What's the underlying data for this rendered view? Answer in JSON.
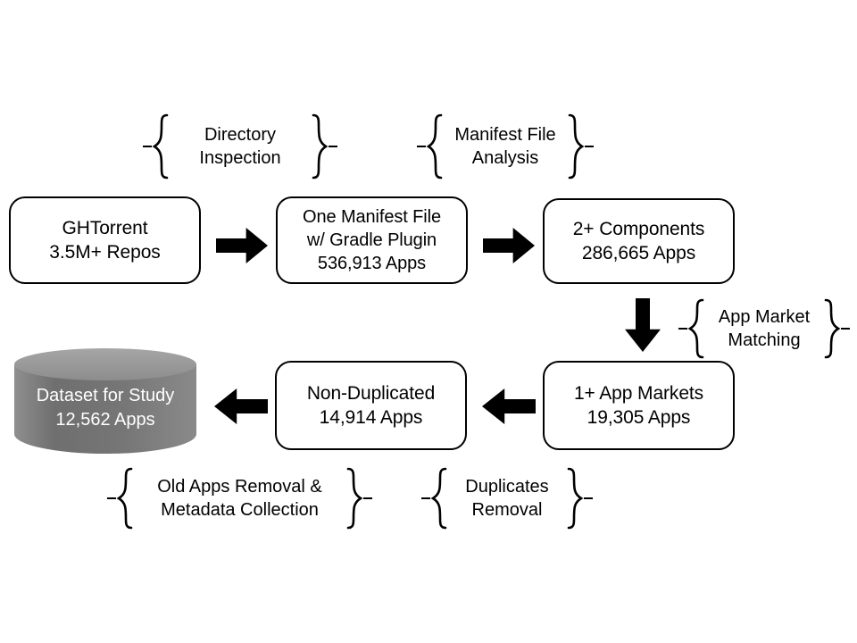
{
  "diagram": {
    "title": "App dataset construction pipeline",
    "background_color": "#ffffff",
    "line_color": "#000000",
    "cylinder_fill": "#767676",
    "cylinder_text_color": "#ffffff",
    "nodes": [
      {
        "id": "ghtorrent",
        "shape": "rounded-rect",
        "lines": [
          "GHTorrent",
          "3.5M+ Repos"
        ]
      },
      {
        "id": "one-manifest-file",
        "shape": "rounded-rect",
        "lines": [
          "One Manifest File",
          "w/ Gradle Plugin",
          "536,913 Apps"
        ]
      },
      {
        "id": "two-plus-components",
        "shape": "rounded-rect",
        "lines": [
          "2+ Components",
          "286,665 Apps"
        ]
      },
      {
        "id": "one-plus-app-markets",
        "shape": "rounded-rect",
        "lines": [
          "1+ App Markets",
          "19,305 Apps"
        ]
      },
      {
        "id": "non-duplicated",
        "shape": "rounded-rect",
        "lines": [
          "Non-Duplicated",
          "14,914 Apps"
        ]
      },
      {
        "id": "dataset-for-study",
        "shape": "cylinder",
        "lines": [
          "Dataset for Study",
          "12,562 Apps"
        ]
      }
    ],
    "annotations": [
      {
        "id": "directory-inspection",
        "lines": [
          "Directory",
          "Inspection"
        ]
      },
      {
        "id": "manifest-file-analysis",
        "lines": [
          "Manifest File",
          "Analysis"
        ]
      },
      {
        "id": "app-market-matching",
        "lines": [
          "App Market",
          "Matching"
        ]
      },
      {
        "id": "duplicates-removal",
        "lines": [
          "Duplicates",
          "Removal"
        ]
      },
      {
        "id": "old-apps-removal",
        "lines": [
          "Old Apps Removal &",
          "Metadata Collection"
        ]
      }
    ],
    "arrows": [
      {
        "id": "arrow-ghtorrent-to-manifest",
        "direction": "right"
      },
      {
        "id": "arrow-manifest-to-components",
        "direction": "right"
      },
      {
        "id": "arrow-components-to-markets",
        "direction": "down"
      },
      {
        "id": "arrow-markets-to-nonduplicated",
        "direction": "left"
      },
      {
        "id": "arrow-nonduplicated-to-dataset",
        "direction": "left"
      }
    ]
  }
}
